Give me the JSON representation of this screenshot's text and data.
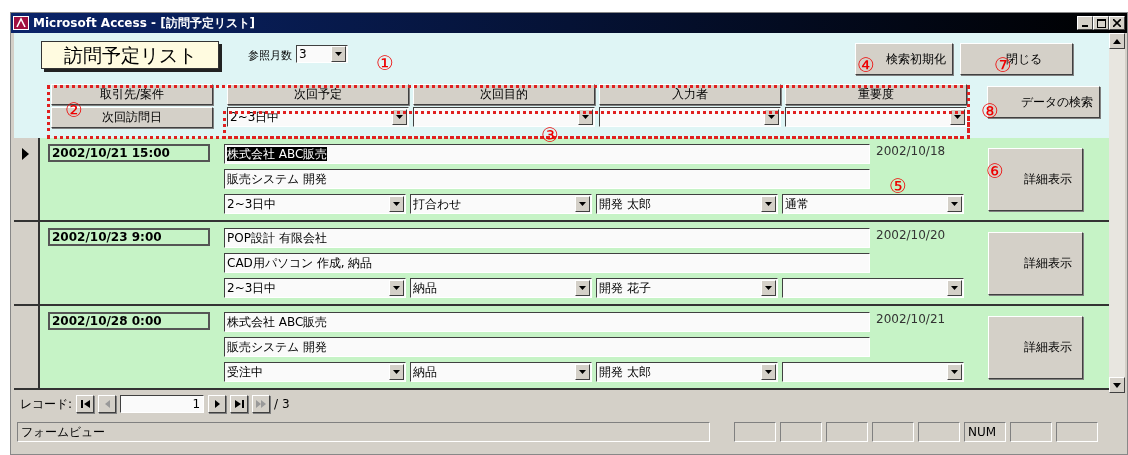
{
  "window": {
    "title": "Microsoft Access - [訪問予定リスト]"
  },
  "form": {
    "title": "訪問予定リスト",
    "months_label": "参照月数",
    "months_value": "3",
    "buttons": [
      {
        "label": "検索初期化"
      },
      {
        "label": "閉じる"
      },
      {
        "label": "データの検索"
      }
    ],
    "columns": [
      "取引先/案件",
      "次回予定",
      "次回目的",
      "入力者",
      "重要度"
    ],
    "sort_button": "次回訪問日",
    "filter_value": "2~3日中"
  },
  "records": [
    {
      "selected": true,
      "visit_date": "2002/10/21 15:00",
      "client": "株式会社 ABC販売",
      "project": "販売システム 開発",
      "schedule": "2~3日中",
      "purpose": "打合わせ",
      "entered_by": "開発 太郎",
      "priority": "通常",
      "entry_date": "2002/10/18",
      "button": "詳細表示"
    },
    {
      "selected": false,
      "visit_date": "2002/10/23 9:00",
      "client": "POP設計 有限会社",
      "project": "CAD用パソコン 作成, 納品",
      "schedule": "2~3日中",
      "purpose": "納品",
      "entered_by": "開発 花子",
      "entry_date": "2002/10/20",
      "button": "詳細表示"
    },
    {
      "selected": false,
      "visit_date": "2002/10/28 0:00",
      "client": "株式会社 ABC販売",
      "project": "販売システム 開発",
      "schedule": "受注中",
      "purpose": "納品",
      "entered_by": "開発 太郎",
      "entry_date": "2002/10/21",
      "button": "詳細表示"
    }
  ],
  "navigation": {
    "label": "レコード:",
    "current": "1",
    "total": "/ 3"
  },
  "status_bar": {
    "text": "フォームビュー",
    "num_lock": "NUM"
  },
  "annotations": [
    "①",
    "④",
    "⑦",
    "②",
    "⑧",
    "③",
    "⑤",
    "⑥"
  ]
}
